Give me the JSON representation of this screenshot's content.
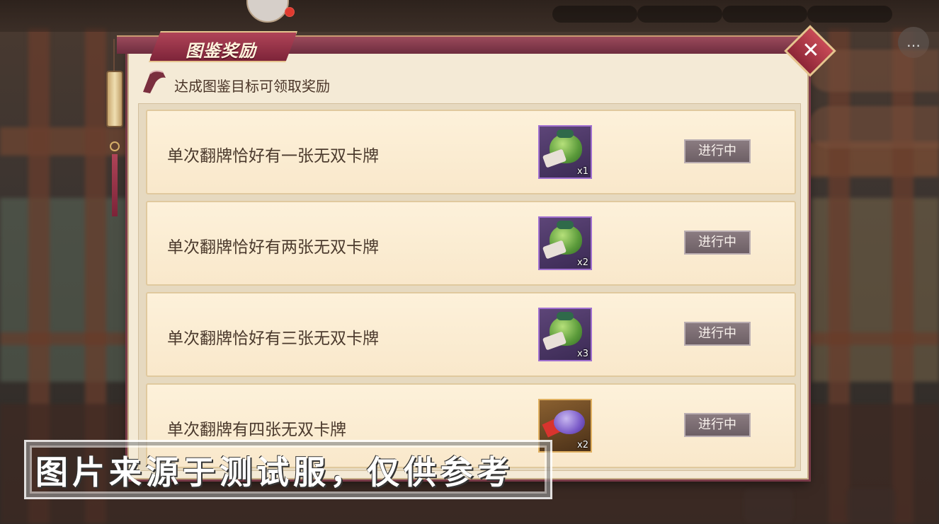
{
  "panel": {
    "title": "图鉴奖励",
    "close_icon": "close-x-icon",
    "subtitle": "达成图鉴目标可领取奖励"
  },
  "rewards": [
    {
      "goal": "单次翻牌恰好有一张无双卡牌",
      "reward_icon": "green-pouch-icon",
      "quantity": "x1",
      "status": "进行中"
    },
    {
      "goal": "单次翻牌恰好有两张无双卡牌",
      "reward_icon": "green-pouch-icon",
      "quantity": "x2",
      "status": "进行中"
    },
    {
      "goal": "单次翻牌恰好有三张无双卡牌",
      "reward_icon": "green-pouch-icon",
      "quantity": "x3",
      "status": "进行中"
    },
    {
      "goal": "单次翻牌有四张无双卡牌",
      "reward_icon": "purple-pouch-icon",
      "quantity": "x2",
      "status": "进行中"
    }
  ],
  "watermark": "图片来源于测试服，仅供参考",
  "colors": {
    "panel_bg": "#f4ead6",
    "header_accent": "#7d2439",
    "status_button": "#7b6d72",
    "text": "#4b3a2d"
  }
}
